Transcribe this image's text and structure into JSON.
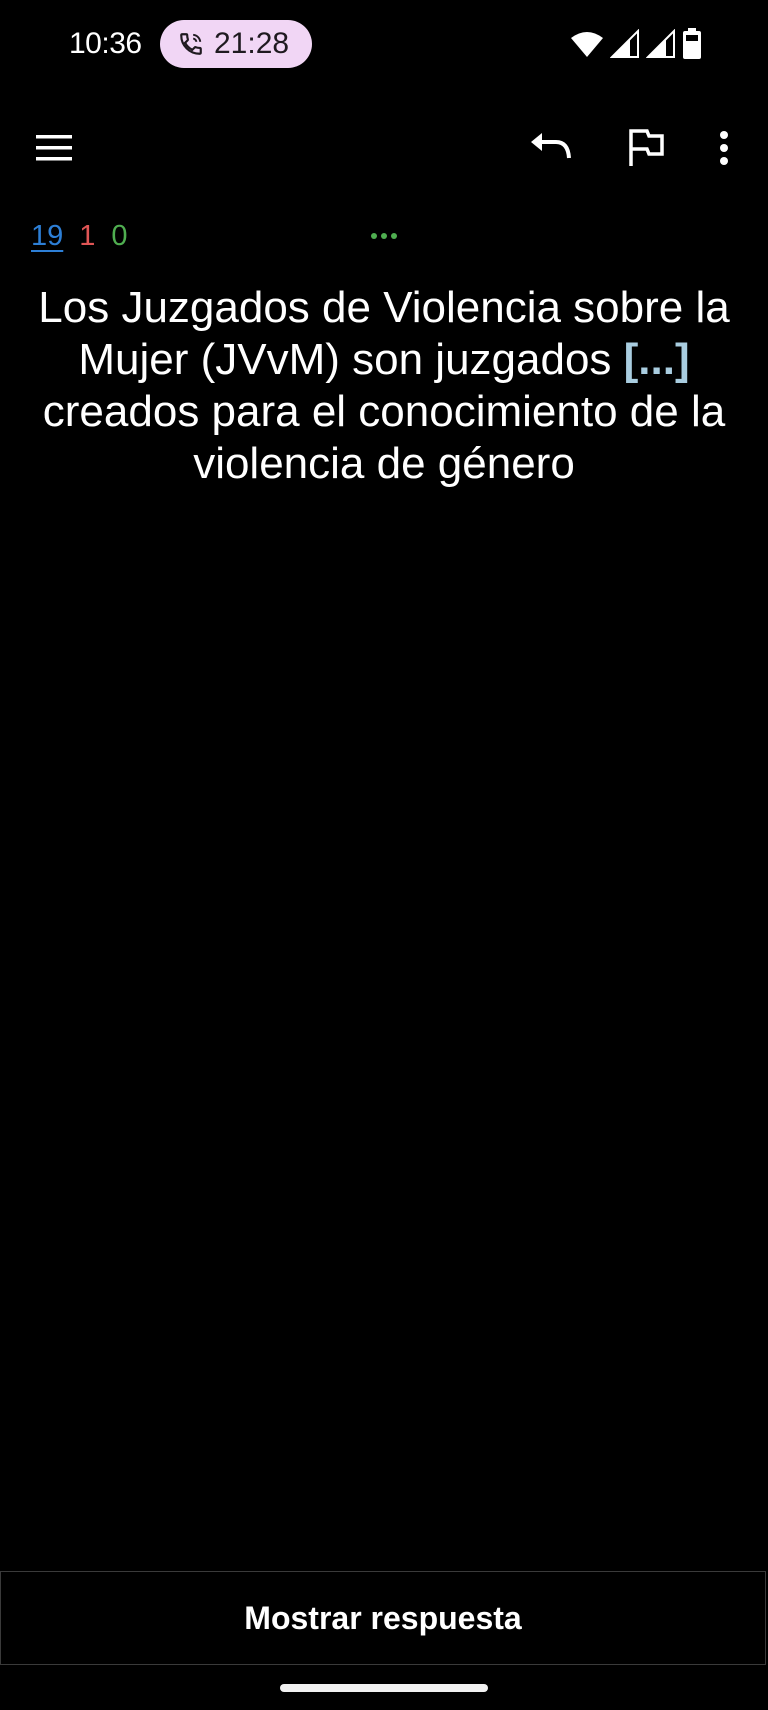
{
  "status_bar": {
    "time": "10:36",
    "call_timer": "21:28",
    "icons": [
      "phone-call-icon",
      "wifi-icon",
      "signal-icon",
      "signal-icon",
      "battery-icon"
    ]
  },
  "toolbar": {
    "icons": [
      "menu-icon",
      "undo-icon",
      "flag-icon",
      "more-vert-icon"
    ]
  },
  "counts": {
    "new": "19",
    "learning": "1",
    "review": "0",
    "colors": {
      "new": "#2d7fd6",
      "learning": "#e05555",
      "review": "#4fae50"
    }
  },
  "card": {
    "text_before": "Los Juzgados de Violencia sobre la Mujer (JVvM) son juzgados ",
    "cloze": "[...]",
    "text_after": " creados para el conocimiento de la violencia de género",
    "cloze_color": "#a9cde0"
  },
  "answer_button": {
    "label": "Mostrar respuesta"
  }
}
